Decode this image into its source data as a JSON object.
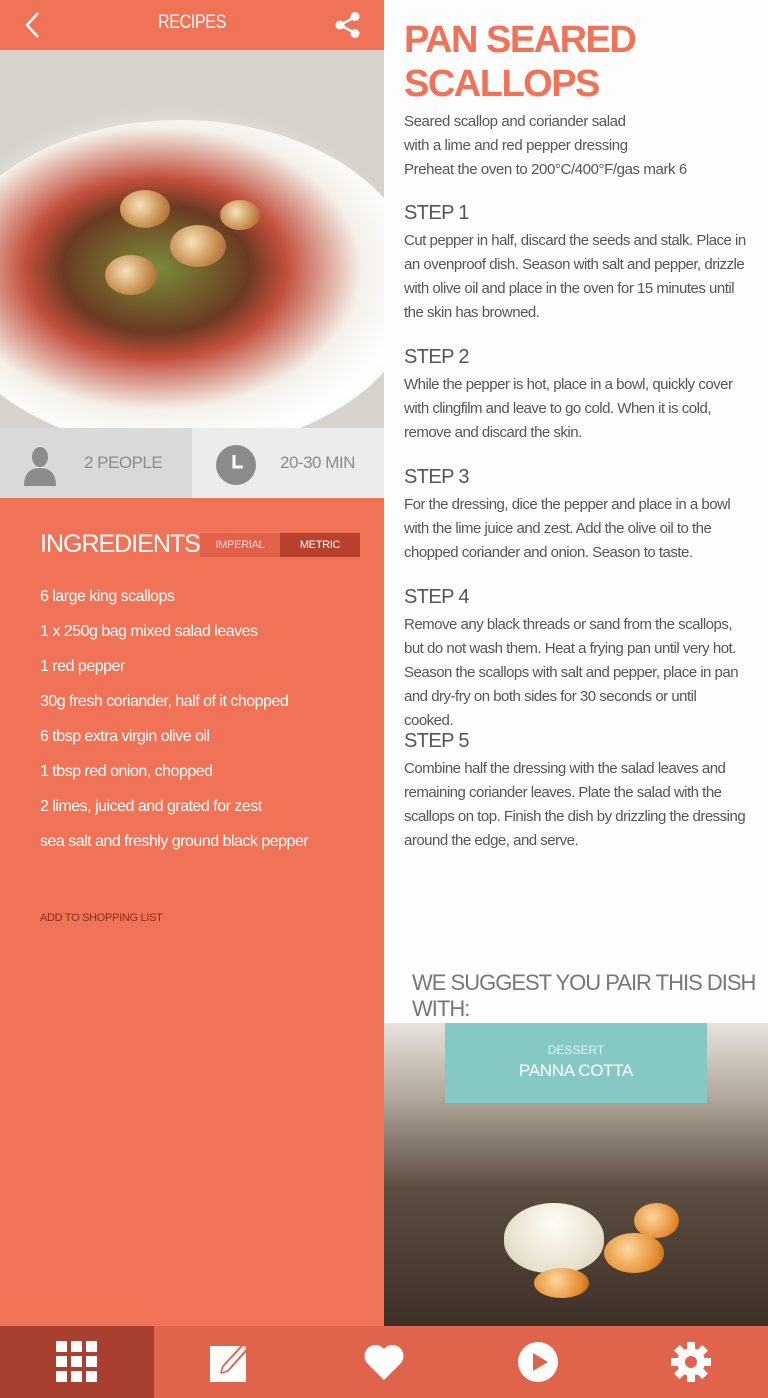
{
  "header": {
    "title": "RECIPES",
    "back_icon": "chevron-left-icon",
    "share_icon": "share-icon"
  },
  "meta": {
    "people": "2 PEOPLE",
    "time": "20-30 MIN"
  },
  "ingredients": {
    "title": "INGREDIENTS",
    "units": {
      "imperial": "IMPERIAL",
      "metric": "METRIC",
      "selected": "METRIC"
    },
    "items": [
      "6 large king scallops",
      "1 x 250g bag mixed salad leaves",
      "1 red pepper",
      "30g fresh coriander, half of it chopped",
      "6 tbsp extra virgin olive oil",
      "1 tbsp red onion, chopped",
      "2 limes, juiced and grated for zest",
      "sea salt and freshly ground black pepper"
    ],
    "add_to_list": "ADD TO SHOPPING LIST"
  },
  "recipe": {
    "title_line1": "PAN SEARED",
    "title_line2": "SCALLOPS",
    "intro_line1": "Seared scallop and coriander salad",
    "intro_line2": "with a lime and red pepper dressing",
    "intro_line3": "Preheat the oven to 200°C/400°F/gas mark 6",
    "steps": [
      {
        "title": "STEP 1",
        "text": "Cut pepper in half, discard the seeds and stalk. Place in an ovenproof dish. Season with salt and pepper, drizzle with olive oil and place in the oven for 15 minutes until the skin has browned."
      },
      {
        "title": "STEP 2",
        "text": "While the pepper is hot, place in a bowl, quickly cover with clingfilm and leave to go cold. When it is cold, remove and discard the skin."
      },
      {
        "title": "STEP 3",
        "text": "For the dressing, dice the pepper and place in a bowl with the lime juice and zest. Add the olive oil to the chopped coriander and onion. Season to taste."
      },
      {
        "title": "STEP 4",
        "text": "Remove any black threads or sand from the scallops, but do not wash them. Heat a frying pan until very hot. Season the scallops with salt and pepper, place in pan and dry-fry on both sides for 30 seconds or until cooked."
      },
      {
        "title": "STEP 5",
        "text": "Combine half the dressing with the salad leaves and remaining coriander leaves. Plate the salad with the scallops on top. Finish the dish by drizzling the dressing around the edge, and serve."
      }
    ]
  },
  "pairing": {
    "heading": "WE SUGGEST YOU PAIR THIS DISH WITH:",
    "category": "DESSERT",
    "dish": "PANNA COTTA"
  },
  "bottom_nav": {
    "items": [
      "grid-icon",
      "edit-icon",
      "heart-icon",
      "play-icon",
      "gear-icon"
    ],
    "active": "grid-icon"
  },
  "colors": {
    "accent": "#f07358",
    "nav": "#e0634c",
    "nav_active": "#a9402f",
    "teal": "#86c8c4"
  }
}
